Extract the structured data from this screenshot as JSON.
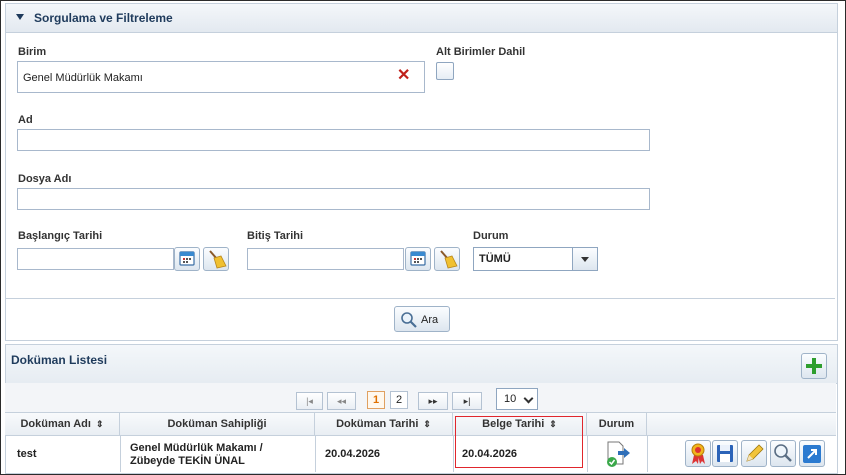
{
  "filter_panel": {
    "title": "Sorgulama ve Filtreleme",
    "birim_label": "Birim",
    "birim_value": "Genel Müdürlük Makamı",
    "alt_birimler_label": "Alt Birimler Dahil",
    "ad_label": "Ad",
    "ad_value": "",
    "dosya_adi_label": "Dosya Adı",
    "dosya_adi_value": "",
    "baslangic_label": "Başlangıç Tarihi",
    "bitis_label": "Bitiş Tarihi",
    "durum_label": "Durum",
    "durum_value": "TÜMÜ",
    "search_label": "Ara"
  },
  "list_panel": {
    "title": "Doküman Listesi",
    "pager": {
      "first": "|◂",
      "prev": "◂◂",
      "pages": [
        "1",
        "2"
      ],
      "active_page": "1",
      "next": "▸▸",
      "last": "▸|",
      "page_size": "10"
    },
    "columns": [
      "Doküman Adı",
      "Doküman Sahipliği",
      "Doküman Tarihi",
      "Belge Tarihi",
      "Durum"
    ],
    "rows": [
      {
        "dokuman_adi": "test",
        "sahiplik_line1": "Genel Müdürlük Makamı /",
        "sahiplik_line2": "Zübeyde TEKİN ÜNAL",
        "dokuman_tarihi": "20.04.2026",
        "belge_tarihi": "20.04.2026"
      }
    ]
  },
  "icons": [
    "chevron-down-icon",
    "clear-x-icon",
    "calendar-icon",
    "broom-icon",
    "magnifier-icon",
    "plus-icon",
    "sort-icon",
    "document-send-icon",
    "award-icon",
    "save-icon",
    "pencil-icon",
    "zoom-icon",
    "external-link-icon"
  ],
  "colors": {
    "header_text": "#1f3b5c",
    "border": "#c5d0dc",
    "highlight": "#e0262d",
    "plus": "#2e9e2e",
    "active_page": "#e07000"
  }
}
